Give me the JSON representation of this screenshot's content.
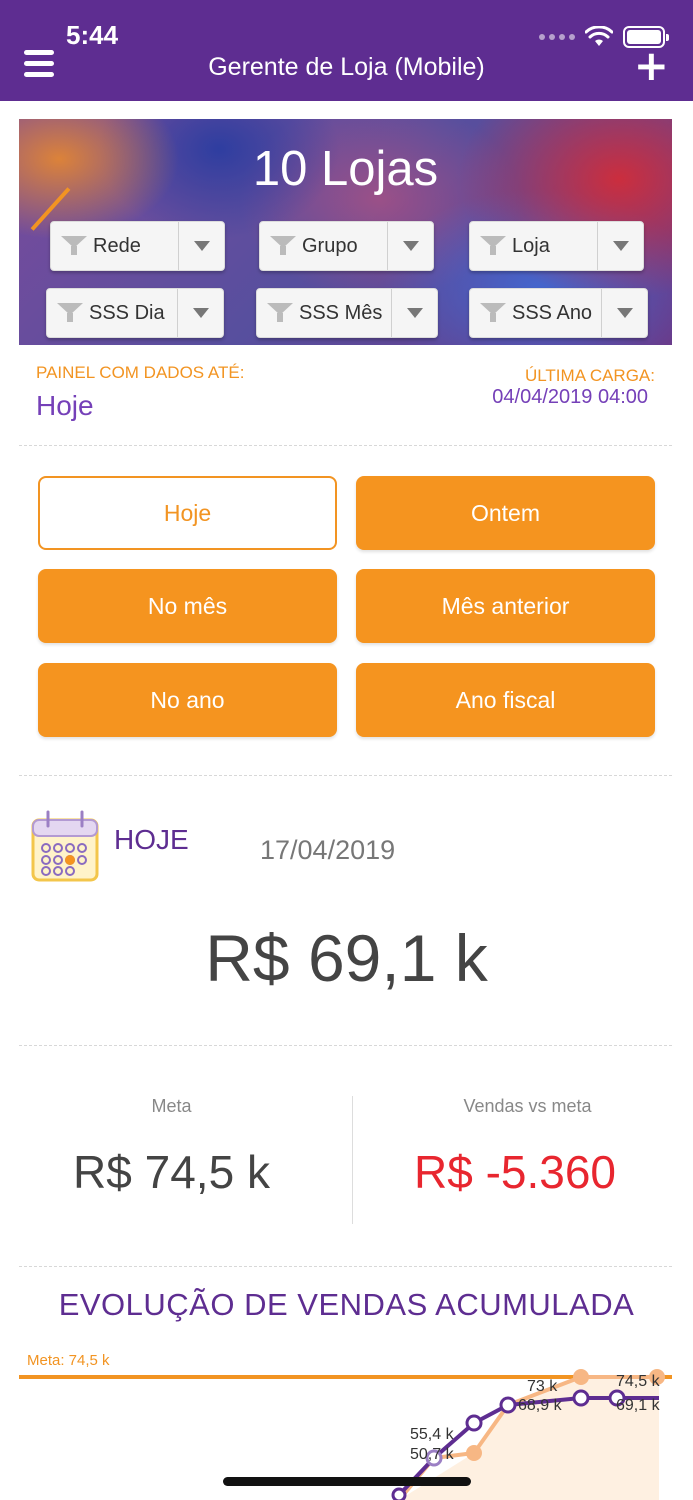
{
  "status_bar": {
    "time": "5:44"
  },
  "header": {
    "title": "Gerente de Loja (Mobile)"
  },
  "banner": {
    "title": "10 Lojas",
    "filters": [
      "Rede",
      "Grupo",
      "Loja",
      "SSS Dia",
      "SSS Mês",
      "SSS Ano"
    ]
  },
  "panel": {
    "label": "PAINEL COM DADOS ATÉ:",
    "value": "Hoje",
    "last_load_label": "ÚLTIMA CARGA:",
    "last_load_value": "04/04/2019 04:00"
  },
  "periods": [
    "Hoje",
    "Ontem",
    "No mês",
    "Mês anterior",
    "No ano",
    "Ano fiscal"
  ],
  "active_period": "Hoje",
  "summary": {
    "label": "HOJE",
    "date": "17/04/2019",
    "value": "R$ 69,1 k"
  },
  "meta": {
    "label": "Meta",
    "value": "R$ 74,5 k"
  },
  "vs_meta": {
    "label": "Vendas vs meta",
    "value": "R$ -5.360"
  },
  "colors": {
    "brand": "#5e2d91",
    "accent": "#f5941f",
    "negative": "#e8262f"
  },
  "chart_title": "EVOLUÇÃO DE VENDAS ACUMULADA",
  "chart_data": {
    "type": "line",
    "title": "EVOLUÇÃO DE VENDAS ACUMULADA",
    "meta_line": {
      "label": "Meta: 74,5 k",
      "value": 74.5
    },
    "series": [
      {
        "values": [
          55.4,
          68.9,
          69.1
        ],
        "labels": [
          "55,4 k",
          "68,9 k",
          "69,1 k"
        ]
      },
      {
        "values": [
          50.7,
          73,
          74.5
        ],
        "labels": [
          "50,7 k",
          "73 k",
          "74,5 k"
        ]
      }
    ]
  }
}
